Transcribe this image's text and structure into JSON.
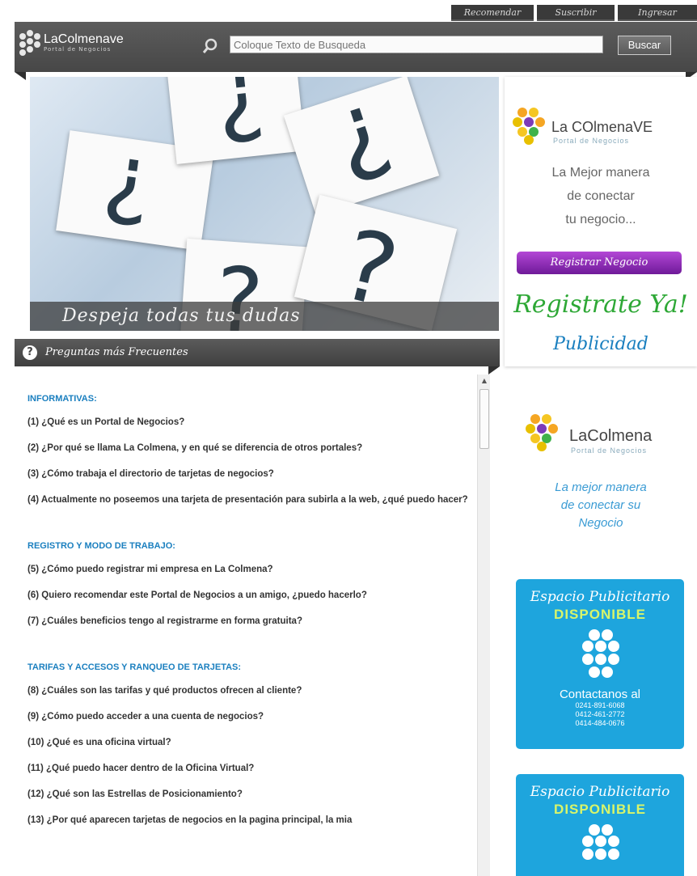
{
  "top_nav": [
    "Recomendar",
    "Suscribir",
    "Ingresar"
  ],
  "header": {
    "logo_name": "LaColmenave",
    "logo_sub": "Portal de Negocios",
    "search_placeholder": "Coloque Texto de Busqueda",
    "search_button": "Buscar"
  },
  "hero": {
    "caption": "Despeja todas tus dudas"
  },
  "faq": {
    "title": "Preguntas más Frecuentes",
    "sections": [
      {
        "title": "INFORMATIVAS:",
        "questions": [
          "(1) ¿Qué es un Portal de Negocios?",
          "(2) ¿Por qué se llama La Colmena, y en qué se diferencia de otros portales?",
          "(3) ¿Cómo trabaja el directorio de tarjetas de negocios?",
          "(4) Actualmente no poseemos una tarjeta de presentación para subirla a la web, ¿qué puedo hacer?"
        ]
      },
      {
        "title": "REGISTRO Y MODO DE TRABAJO:",
        "questions": [
          "(5) ¿Cómo puedo registrar mi empresa en La Colmena?",
          "(6) Quiero recomendar este Portal de Negocios a un amigo, ¿puedo hacerlo?",
          "(7) ¿Cuáles beneficios tengo al registrarme en forma gratuita?"
        ]
      },
      {
        "title": "TARIFAS Y ACCESOS Y RANQUEO DE TARJETAS:",
        "questions": [
          "(8) ¿Cuáles son las tarifas y qué productos ofrecen al cliente?",
          "(9) ¿Cómo puedo acceder a una cuenta de negocios?",
          "(10) ¿Qué es una oficina virtual?",
          "(11) ¿Qué puedo hacer dentro de la Oficina Virtual?",
          "(12) ¿Qué son las Estrellas de Posicionamiento?",
          "(13) ¿Por qué aparecen tarjetas de negocios en la pagina principal, la mia"
        ]
      }
    ]
  },
  "sidebar": {
    "logo_name": "La COlmenaVE",
    "logo_sub": "Portal de Negocios",
    "slogan_lines": [
      "La Mejor manera",
      "de conectar",
      "tu negocio..."
    ],
    "register_button": "Registrar Negocio",
    "register_now": "Registrate Ya!",
    "publicidad": "Publicidad"
  },
  "ad_logo": {
    "name": "LaColmena",
    "sub": "Portal de Negocios",
    "slogan_lines": [
      "La mejor manera",
      "de conectar su",
      "Negocio"
    ]
  },
  "ads": [
    {
      "title": "Espacio Publicitario",
      "status": "DISPONIBLE",
      "contact": "Contactanos al",
      "phones": [
        "0241-891-6068",
        "0412-461-2772",
        "0414-484-0676"
      ]
    },
    {
      "title": "Espacio Publicitario",
      "status": "DISPONIBLE"
    }
  ],
  "colors": {
    "header_bg": "#4e4e4e",
    "section_title": "#1a7fbf",
    "register_button": "#8a2bb5",
    "register_now": "#2ea836",
    "ad_bg": "#1ea5dd"
  }
}
